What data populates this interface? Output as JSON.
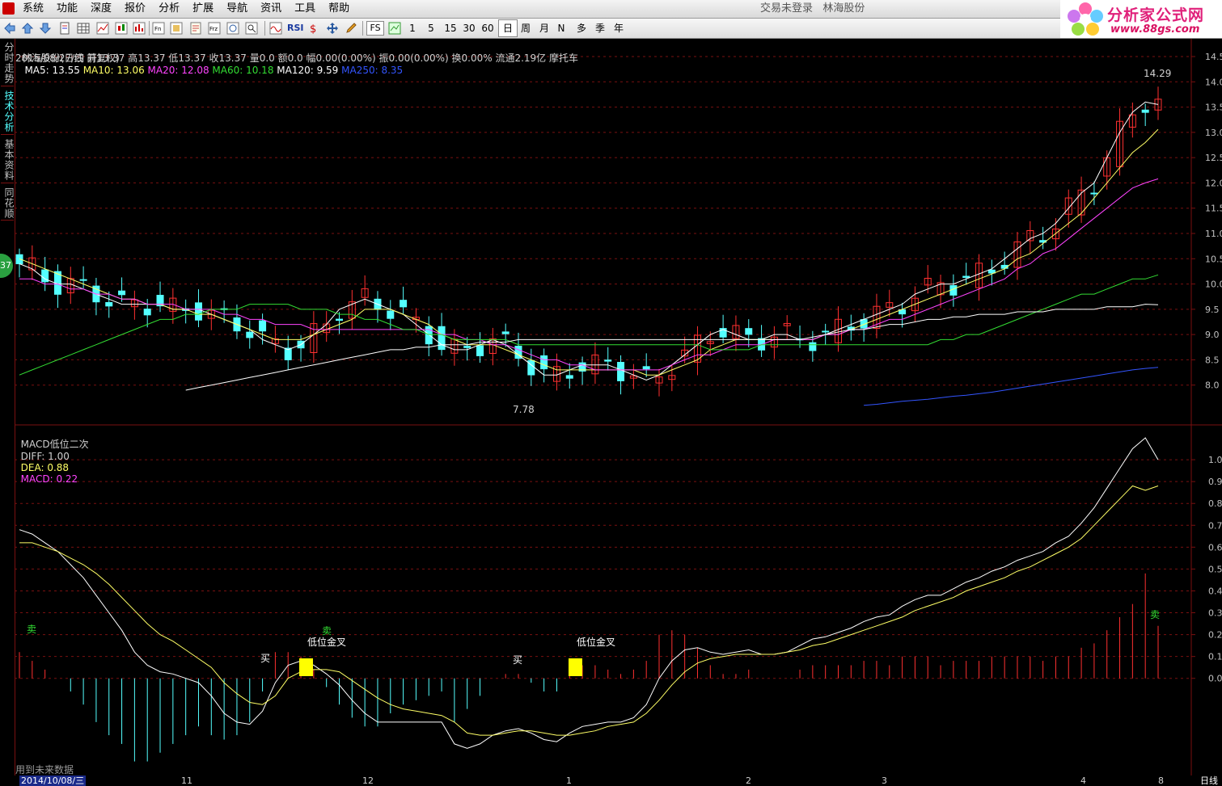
{
  "menu": {
    "items": [
      "系统",
      "功能",
      "深度",
      "报价",
      "分析",
      "扩展",
      "导航",
      "资讯",
      "工具",
      "帮助"
    ]
  },
  "status": {
    "login": "交易未登录",
    "stock": "林海股份"
  },
  "toolbar": {
    "periods": [
      "1",
      "5",
      "15",
      "30",
      "60",
      "日",
      "周",
      "月",
      "N",
      "多",
      "季",
      "年"
    ],
    "rsi_label": "RSI",
    "fs_label": "FS"
  },
  "brand": {
    "title": "分析家公式网",
    "url": "www.88gs.com"
  },
  "sidebar": {
    "tabs": [
      "分时走势",
      "技术分析",
      "基本资料",
      "同花顺"
    ],
    "badge": "37"
  },
  "header": {
    "title": "林海股份(日线 前复权)",
    "ma": [
      {
        "label": "MA5: 13.55",
        "color": "#ffffff"
      },
      {
        "label": "MA10: 13.06",
        "color": "#ffff66"
      },
      {
        "label": "MA20: 12.08",
        "color": "#ff44ff"
      },
      {
        "label": "MA60: 10.18",
        "color": "#33dd33"
      },
      {
        "label": "MA120: 9.59",
        "color": "#ffffff"
      },
      {
        "label": "MA250: 8.35",
        "color": "#3355ff"
      }
    ],
    "quote": "2015/08/27/四 开13.37 高13.37 低13.37 收13.37 量0.0 额0.0 幅0.00(0.00%) 振0.00(0.00%) 换0.00% 流通2.19亿 摩托车"
  },
  "price_axis": {
    "ticks": [
      "14.5",
      "14.0",
      "13.5",
      "13.0",
      "12.5",
      "12.0",
      "11.5",
      "11.0",
      "10.5",
      "10.0",
      "9.5",
      "9.0",
      "8.5",
      "8.0"
    ]
  },
  "price_markers": {
    "high": "14.29",
    "low": "7.78"
  },
  "macd": {
    "title": "MACD低位二次",
    "diff": "DIFF: 1.00",
    "dea": "DEA: 0.88",
    "macd": "MACD: 0.22",
    "ticks": [
      "1.0",
      "0.9",
      "0.8",
      "0.7",
      "0.6",
      "0.5",
      "0.4",
      "0.3",
      "0.2",
      "0.1",
      "0.0"
    ],
    "annotations": {
      "sell": "卖",
      "buy": "买",
      "golden_cross": "低位金叉"
    },
    "note": "用到未来数据"
  },
  "date_axis": {
    "start": "2014/10/08/三",
    "months": [
      "11",
      "12",
      "1",
      "2",
      "3",
      "4",
      "8"
    ],
    "period": "日线"
  },
  "colors": {
    "up": "#ff3030",
    "down": "#54ffff",
    "grid": "#7a1010",
    "signal": "#ffff00"
  },
  "chart_data": [
    {
      "type": "candlestick",
      "title": "林海股份(日线 前复权)",
      "series": [
        {
          "name": "MA5",
          "values": [
            10.4,
            10.3,
            10.1,
            10.0,
            10.0,
            9.9,
            9.8,
            9.7,
            9.6,
            9.6,
            9.6,
            9.6,
            9.5,
            9.5,
            9.5,
            9.4,
            9.3,
            9.2,
            9.1,
            8.9,
            8.8,
            8.7,
            8.8,
            9.0,
            9.2,
            9.5,
            9.6,
            9.7,
            9.6,
            9.5,
            9.4,
            9.2,
            9.0,
            8.8,
            8.7,
            8.7,
            8.8,
            8.9,
            8.8,
            8.6,
            8.4,
            8.2,
            8.2,
            8.3,
            8.4,
            8.4,
            8.4,
            8.3,
            8.2,
            8.1,
            8.2,
            8.4,
            8.6,
            8.8,
            9.0,
            9.1,
            9.0,
            8.9,
            8.9,
            9.0,
            9.0,
            8.9,
            8.9,
            9.0,
            9.1,
            9.2,
            9.3,
            9.4,
            9.5,
            9.6,
            9.8,
            9.9,
            10.0,
            10.0,
            10.1,
            10.2,
            10.3,
            10.5,
            10.7,
            10.9,
            11.0,
            11.2,
            11.5,
            11.8,
            12.0,
            12.5,
            13.0,
            13.4,
            13.6,
            13.55
          ]
        },
        {
          "name": "MA10",
          "values": [
            10.5,
            10.4,
            10.3,
            10.2,
            10.1,
            10.0,
            9.9,
            9.8,
            9.7,
            9.7,
            9.6,
            9.6,
            9.5,
            9.5,
            9.4,
            9.4,
            9.3,
            9.2,
            9.1,
            9.0,
            8.9,
            8.9,
            8.9,
            9.0,
            9.1,
            9.2,
            9.3,
            9.5,
            9.5,
            9.5,
            9.4,
            9.3,
            9.2,
            9.0,
            8.9,
            8.8,
            8.8,
            8.8,
            8.7,
            8.6,
            8.5,
            8.4,
            8.3,
            8.3,
            8.3,
            8.3,
            8.3,
            8.3,
            8.3,
            8.2,
            8.2,
            8.3,
            8.4,
            8.5,
            8.7,
            8.8,
            8.9,
            8.9,
            8.9,
            8.9,
            8.9,
            8.9,
            8.9,
            9.0,
            9.0,
            9.1,
            9.2,
            9.3,
            9.4,
            9.5,
            9.6,
            9.7,
            9.8,
            9.9,
            10.0,
            10.1,
            10.2,
            10.3,
            10.5,
            10.6,
            10.8,
            11.0,
            11.2,
            11.4,
            11.7,
            12.0,
            12.3,
            12.6,
            12.8,
            13.06
          ]
        },
        {
          "name": "MA20",
          "values": [
            10.1,
            10.1,
            10.0,
            10.0,
            9.9,
            9.9,
            9.8,
            9.8,
            9.7,
            9.7,
            9.6,
            9.6,
            9.6,
            9.5,
            9.5,
            9.5,
            9.4,
            9.4,
            9.3,
            9.3,
            9.2,
            9.2,
            9.2,
            9.1,
            9.1,
            9.1,
            9.1,
            9.1,
            9.1,
            9.1,
            9.1,
            9.1,
            9.1,
            9.0,
            9.0,
            8.9,
            8.9,
            8.8,
            8.8,
            8.7,
            8.6,
            8.5,
            8.5,
            8.4,
            8.4,
            8.3,
            8.3,
            8.3,
            8.3,
            8.3,
            8.3,
            8.4,
            8.5,
            8.6,
            8.6,
            8.7,
            8.8,
            8.8,
            8.8,
            8.9,
            8.9,
            8.9,
            8.9,
            9.0,
            9.0,
            9.1,
            9.1,
            9.2,
            9.3,
            9.3,
            9.4,
            9.5,
            9.6,
            9.7,
            9.8,
            9.9,
            10.0,
            10.1,
            10.3,
            10.4,
            10.6,
            10.7,
            10.9,
            11.1,
            11.3,
            11.5,
            11.7,
            11.9,
            12.0,
            12.08
          ]
        },
        {
          "name": "MA60",
          "values": [
            8.2,
            8.3,
            8.4,
            8.5,
            8.6,
            8.7,
            8.8,
            8.9,
            9.0,
            9.1,
            9.2,
            9.3,
            9.3,
            9.4,
            9.4,
            9.5,
            9.5,
            9.5,
            9.6,
            9.6,
            9.6,
            9.6,
            9.5,
            9.5,
            9.5,
            9.4,
            9.4,
            9.3,
            9.3,
            9.2,
            9.1,
            9.1,
            9.0,
            9.0,
            8.9,
            8.9,
            8.9,
            8.9,
            8.9,
            8.8,
            8.8,
            8.8,
            8.8,
            8.8,
            8.8,
            8.8,
            8.8,
            8.8,
            8.8,
            8.8,
            8.8,
            8.8,
            8.8,
            8.8,
            8.7,
            8.7,
            8.7,
            8.7,
            8.8,
            8.8,
            8.8,
            8.8,
            8.8,
            8.8,
            8.8,
            8.8,
            8.8,
            8.8,
            8.8,
            8.8,
            8.8,
            8.8,
            8.9,
            8.9,
            9.0,
            9.0,
            9.1,
            9.2,
            9.3,
            9.4,
            9.5,
            9.6,
            9.7,
            9.8,
            9.8,
            9.9,
            10.0,
            10.1,
            10.1,
            10.18
          ]
        },
        {
          "name": "MA120",
          "values": [
            null,
            null,
            null,
            null,
            null,
            null,
            null,
            null,
            null,
            null,
            null,
            null,
            null,
            7.9,
            7.95,
            8.0,
            8.05,
            8.1,
            8.15,
            8.2,
            8.25,
            8.3,
            8.35,
            8.4,
            8.45,
            8.5,
            8.55,
            8.6,
            8.65,
            8.7,
            8.7,
            8.75,
            8.75,
            8.8,
            8.8,
            8.8,
            8.85,
            8.85,
            8.85,
            8.9,
            8.9,
            8.9,
            8.9,
            8.9,
            8.9,
            8.9,
            8.9,
            8.9,
            8.9,
            8.9,
            8.9,
            8.9,
            8.9,
            8.9,
            8.9,
            8.9,
            8.9,
            8.9,
            8.9,
            8.9,
            8.9,
            8.9,
            8.95,
            9.0,
            9.05,
            9.1,
            9.1,
            9.15,
            9.2,
            9.2,
            9.25,
            9.3,
            9.3,
            9.35,
            9.35,
            9.4,
            9.4,
            9.4,
            9.45,
            9.45,
            9.45,
            9.5,
            9.5,
            9.5,
            9.5,
            9.55,
            9.55,
            9.55,
            9.6,
            9.59
          ]
        },
        {
          "name": "MA250",
          "values": [
            null,
            null,
            null,
            null,
            null,
            null,
            null,
            null,
            null,
            null,
            null,
            null,
            null,
            null,
            null,
            null,
            null,
            null,
            null,
            null,
            null,
            null,
            null,
            null,
            null,
            null,
            null,
            null,
            null,
            null,
            null,
            null,
            null,
            null,
            null,
            null,
            null,
            null,
            null,
            null,
            null,
            null,
            null,
            null,
            null,
            null,
            null,
            null,
            null,
            null,
            null,
            null,
            null,
            null,
            null,
            null,
            null,
            null,
            null,
            null,
            null,
            null,
            null,
            null,
            null,
            null,
            7.6,
            7.62,
            7.65,
            7.68,
            7.7,
            7.72,
            7.75,
            7.78,
            7.8,
            7.83,
            7.86,
            7.9,
            7.94,
            7.98,
            8.02,
            8.06,
            8.1,
            8.14,
            8.18,
            8.22,
            8.26,
            8.3,
            8.33,
            8.35
          ]
        }
      ],
      "ylim": [
        7.5,
        14.5
      ]
    },
    {
      "type": "bar",
      "title": "MACD低位二次",
      "series": [
        {
          "name": "DIFF",
          "values": [
            0.68,
            0.66,
            0.62,
            0.58,
            0.52,
            0.46,
            0.38,
            0.3,
            0.22,
            0.12,
            0.06,
            0.03,
            0.02,
            0.0,
            -0.02,
            -0.08,
            -0.16,
            -0.2,
            -0.21,
            -0.15,
            -0.02,
            0.06,
            0.08,
            0.06,
            0.02,
            -0.03,
            -0.1,
            -0.16,
            -0.2,
            -0.2,
            -0.2,
            -0.2,
            -0.2,
            -0.2,
            -0.3,
            -0.32,
            -0.3,
            -0.26,
            -0.24,
            -0.23,
            -0.25,
            -0.28,
            -0.29,
            -0.25,
            -0.22,
            -0.21,
            -0.2,
            -0.2,
            -0.18,
            -0.12,
            0.0,
            0.08,
            0.13,
            0.14,
            0.12,
            0.11,
            0.12,
            0.13,
            0.11,
            0.11,
            0.12,
            0.15,
            0.18,
            0.19,
            0.21,
            0.23,
            0.26,
            0.28,
            0.29,
            0.33,
            0.36,
            0.38,
            0.38,
            0.41,
            0.44,
            0.46,
            0.49,
            0.51,
            0.54,
            0.56,
            0.58,
            0.62,
            0.65,
            0.71,
            0.78,
            0.87,
            0.96,
            1.05,
            1.1,
            1.0
          ]
        },
        {
          "name": "DEA",
          "values": [
            0.62,
            0.62,
            0.6,
            0.58,
            0.55,
            0.52,
            0.48,
            0.43,
            0.37,
            0.31,
            0.25,
            0.2,
            0.17,
            0.13,
            0.09,
            0.05,
            -0.02,
            -0.07,
            -0.11,
            -0.12,
            -0.08,
            0.0,
            0.03,
            0.04,
            0.04,
            0.03,
            -0.01,
            -0.05,
            -0.09,
            -0.12,
            -0.14,
            -0.15,
            -0.16,
            -0.17,
            -0.2,
            -0.25,
            -0.26,
            -0.26,
            -0.25,
            -0.24,
            -0.24,
            -0.25,
            -0.26,
            -0.26,
            -0.25,
            -0.24,
            -0.22,
            -0.21,
            -0.2,
            -0.16,
            -0.1,
            -0.03,
            0.03,
            0.07,
            0.09,
            0.1,
            0.11,
            0.11,
            0.11,
            0.11,
            0.12,
            0.13,
            0.15,
            0.16,
            0.18,
            0.2,
            0.22,
            0.24,
            0.26,
            0.28,
            0.31,
            0.33,
            0.35,
            0.37,
            0.4,
            0.42,
            0.44,
            0.46,
            0.49,
            0.51,
            0.54,
            0.57,
            0.6,
            0.64,
            0.7,
            0.76,
            0.82,
            0.88,
            0.86,
            0.88
          ]
        }
      ],
      "xlabel": "",
      "ylabel": "",
      "ylim": [
        -0.4,
        1.1
      ]
    }
  ]
}
